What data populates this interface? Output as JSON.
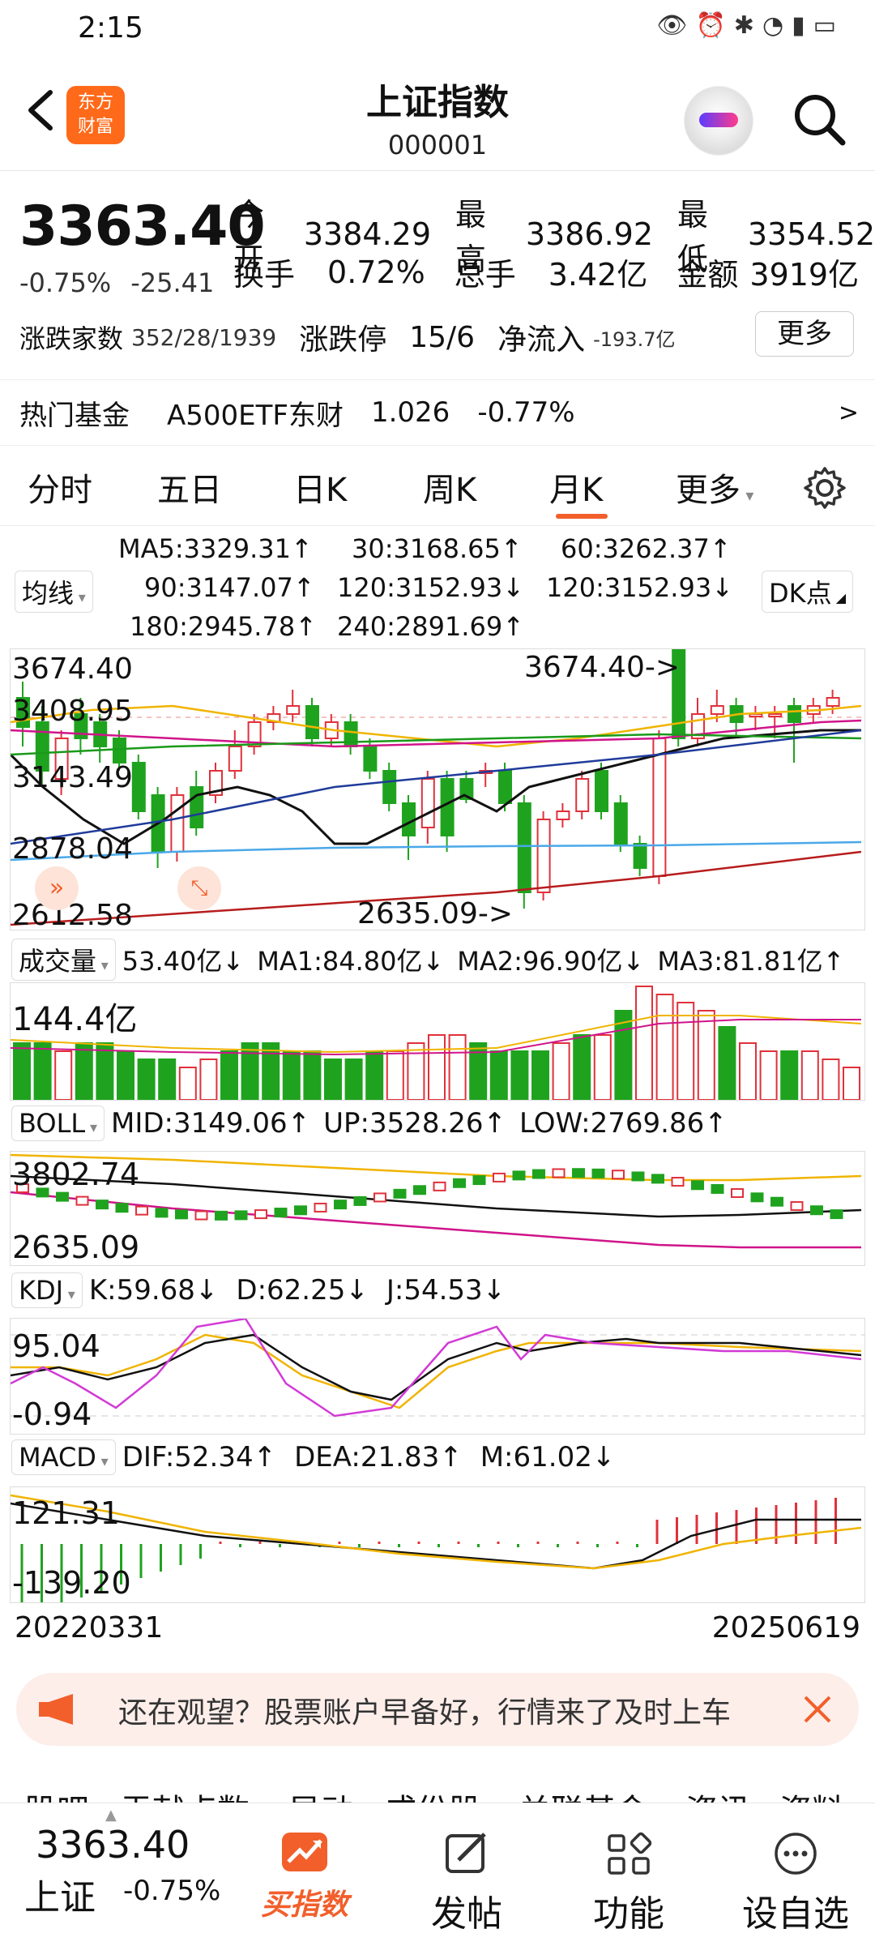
{
  "status": {
    "time": "2:15"
  },
  "header": {
    "title": "上证指数",
    "code": "000001",
    "logo_text": [
      "东方",
      "财富"
    ]
  },
  "quote": {
    "price": "3363.40",
    "change_pct": "-0.75%",
    "change_val": "-25.41",
    "open_label": "今开",
    "open": "3384.29",
    "high_label": "最高",
    "high": "3386.92",
    "low_label": "最低",
    "low": "3354.52",
    "turn_label": "换手",
    "turn": "0.72%",
    "vol_label": "总手",
    "vol": "3.42亿",
    "amt_label": "金额",
    "amt": "3919亿",
    "breadth_label": "涨跌家数",
    "breadth": "352/28/1939",
    "limit_label": "涨跌停",
    "limit": "15/6",
    "flow_label": "净流入",
    "flow": "-193.7亿",
    "more": "更多"
  },
  "fund": {
    "label": "热门基金",
    "name": "A500ETF东财",
    "price": "1.026",
    "pct": "-0.77%",
    "arrow": ">"
  },
  "tabs": [
    {
      "label": "分时"
    },
    {
      "label": "五日"
    },
    {
      "label": "日K"
    },
    {
      "label": "周K"
    },
    {
      "label": "月K",
      "active": true
    },
    {
      "label": "更多"
    }
  ],
  "ma": {
    "selector": "均线",
    "dk": "DK点",
    "ma5": "MA5:3329.31↑",
    "ma30": "30:3168.65↑",
    "ma60": "60:3262.37↑",
    "ma90": "90:3147.07↑",
    "ma120a": "120:3152.93↓",
    "ma120b": "120:3152.93↓",
    "ma180": "180:2945.78↑",
    "ma240": "240:2891.69↑"
  },
  "kline": {
    "y": [
      "3674.40",
      "3408.95",
      "3143.49",
      "2878.04",
      "2612.58"
    ],
    "hi": "3674.40->",
    "lo": "2635.09->"
  },
  "volume": {
    "selector": "成交量",
    "v": "53.40亿↓",
    "ma1": "MA1:84.80亿↓",
    "ma2": "MA2:96.90亿↓",
    "ma3": "MA3:81.81亿↑",
    "ymax": "144.4亿"
  },
  "boll": {
    "selector": "BOLL",
    "mid": "MID:3149.06↑",
    "up": "UP:3528.26↑",
    "low": "LOW:2769.86↑",
    "ymax": "3802.74",
    "ymin": "2635.09"
  },
  "kdj": {
    "selector": "KDJ",
    "k": "K:59.68↓",
    "d": "D:62.25↓",
    "j": "J:54.53↓",
    "ymax": "95.04",
    "ymin": "-0.94"
  },
  "macd": {
    "selector": "MACD",
    "dif": "DIF:52.34↑",
    "dea": "DEA:21.83↑",
    "m": "M:61.02↓",
    "ymax": "121.31",
    "ymin": "-139.20"
  },
  "dates": {
    "start": "20220331",
    "end": "20250619"
  },
  "banner": {
    "text": "还在观望？股票账户早备好，行情来了及时上车"
  },
  "subtabs": [
    "股吧",
    "贡献点数",
    "异动",
    "成份股",
    "关联基金",
    "资讯",
    "资料"
  ],
  "bottom": {
    "price": "3363.40",
    "name": "上证",
    "pct": "-0.75%",
    "buy": "买指数",
    "post": "发帖",
    "func": "功能",
    "fav": "设自选"
  },
  "colors": {
    "up": "#e0313b",
    "down": "#1fa31f",
    "accent": "#f25f2b",
    "ma5": "#111111",
    "ma30": "#f0b400",
    "ma60": "#d0148a",
    "ma90": "#1a9a1a",
    "ma120": "#1f3b9a",
    "ma180": "#4aa8e8",
    "ma240": "#b71c1c"
  }
}
